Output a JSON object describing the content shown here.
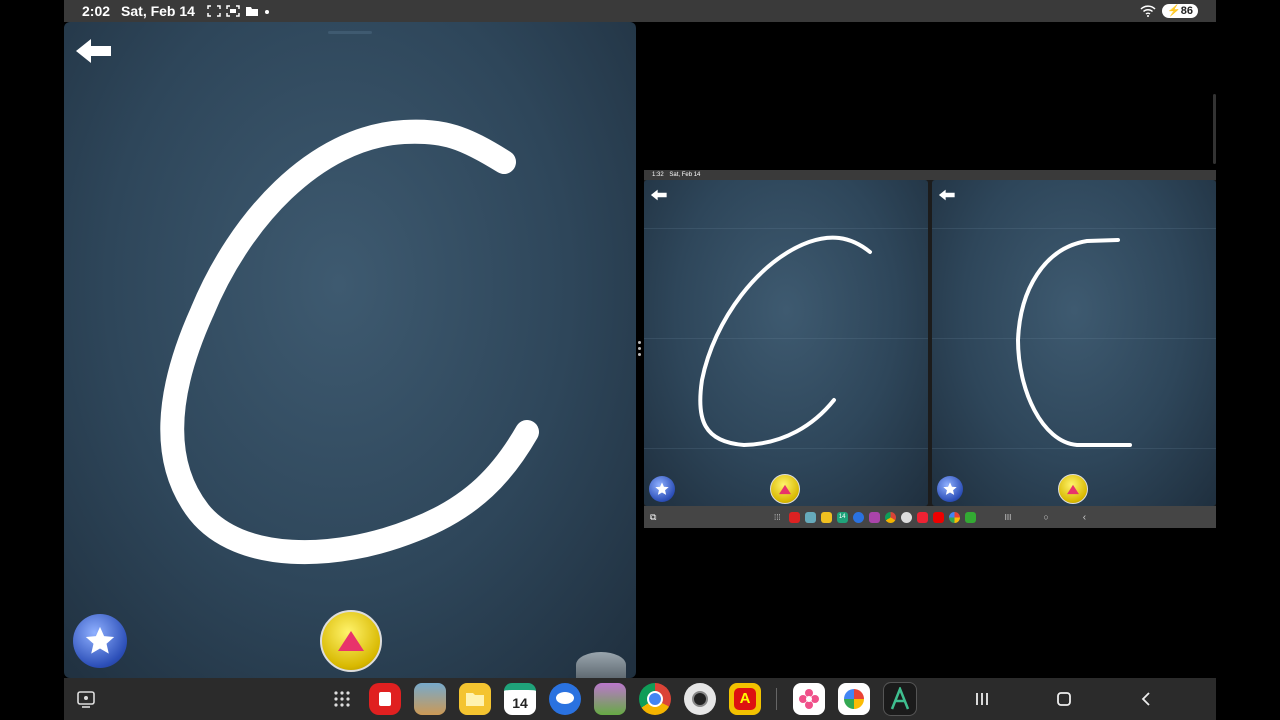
{
  "status_bar": {
    "time": "2:02",
    "date": "Sat, Feb 14",
    "battery": "86"
  },
  "left_app": {
    "letter": "C",
    "icons": [
      "back-arrow-icon",
      "star-icon",
      "triangle-up-icon"
    ]
  },
  "right_app": {
    "mini_status": {
      "time": "1:32",
      "date": "Sat, Feb 14"
    }
  },
  "taskbar": {
    "calendar_day": "14",
    "mini_calendar_day": "14",
    "apps": [
      "recent-apps-icon",
      "app-grid-icon",
      "red-app-icon",
      "game-app-icon",
      "files-app-icon",
      "calendar-app-icon",
      "messages-app-icon",
      "cat-game-app-icon",
      "chrome-app-icon",
      "camera-app-icon",
      "alphabet-app-icon",
      "flower-app-icon",
      "photos-app-icon",
      "letter-a-app-icon"
    ],
    "nav": [
      "recents-nav-icon",
      "home-nav-icon",
      "back-nav-icon"
    ]
  },
  "colors": {
    "board": "#2e465a",
    "stroke": "#ffffff",
    "status_bar": "#3a3a3a",
    "taskbar": "#2b2b2b"
  }
}
